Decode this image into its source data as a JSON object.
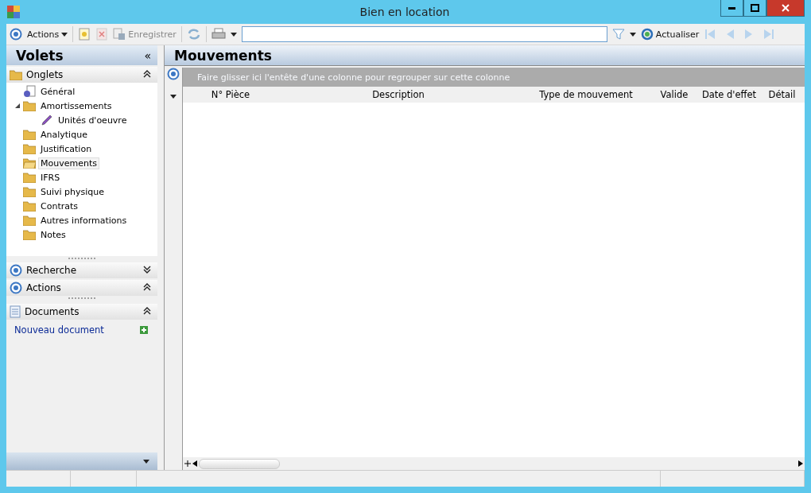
{
  "window": {
    "title": "Bien en location"
  },
  "toolbar": {
    "actions_menu": "Actions",
    "save": {
      "label": "Enregistrer",
      "disabled": true
    },
    "refresh": "Actualiser"
  },
  "sidebar": {
    "title": "Volets",
    "collapse_glyph": "«",
    "panels": [
      {
        "kind": "tree",
        "title": "Onglets",
        "expanded": true,
        "items": [
          {
            "label": "Général",
            "kind": "page",
            "selected": false
          },
          {
            "label": "Amortissements",
            "kind": "folder",
            "selected": false,
            "expanded": true,
            "children": [
              {
                "label": "Unités d'oeuvre",
                "kind": "tool",
                "selected": false
              }
            ]
          },
          {
            "label": "Analytique",
            "kind": "folder",
            "selected": false
          },
          {
            "label": "Justification",
            "kind": "folder",
            "selected": false
          },
          {
            "label": "Mouvements",
            "kind": "folder",
            "selected": true
          },
          {
            "label": "IFRS",
            "kind": "folder",
            "selected": false
          },
          {
            "label": "Suivi physique",
            "kind": "folder",
            "selected": false
          },
          {
            "label": "Contrats",
            "kind": "folder",
            "selected": false
          },
          {
            "label": "Autres informations",
            "kind": "folder",
            "selected": false
          },
          {
            "label": "Notes",
            "kind": "folder",
            "selected": false
          }
        ]
      },
      {
        "kind": "section",
        "title": "Recherche",
        "expanded": false
      },
      {
        "kind": "section",
        "title": "Actions",
        "expanded": true
      },
      {
        "kind": "documents",
        "title": "Documents",
        "expanded": true,
        "links": [
          "Nouveau document"
        ]
      }
    ]
  },
  "main": {
    "title": "Mouvements",
    "group_hint": "Faire glisser ici l'entête d'une colonne pour regrouper sur cette colonne",
    "columns": [
      "N° Pièce",
      "Description",
      "Type de mouvement",
      "Valide",
      "Date d'effet",
      "Détail"
    ]
  }
}
